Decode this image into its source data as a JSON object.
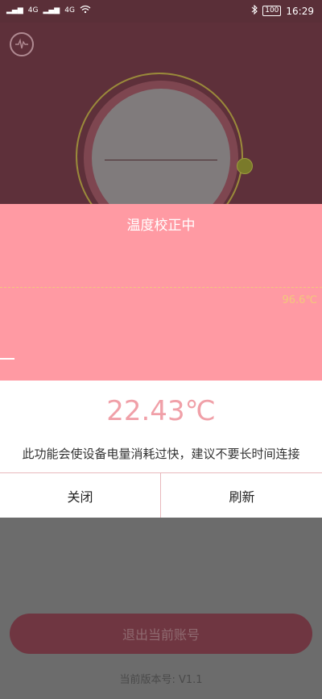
{
  "status_bar": {
    "left_indicators": [
      "4G",
      "4G"
    ],
    "battery": "100",
    "time": "16:29"
  },
  "calibration": {
    "title": "温度校正中",
    "reference_value": "96.6℃"
  },
  "panel": {
    "temperature": "22.43℃",
    "warning": "此功能会使设备电量消耗过快，建议不要长时间连接",
    "close_label": "关闭",
    "refresh_label": "刷新"
  },
  "footer": {
    "logout_label": "退出当前账号",
    "version_label": "当前版本号: V1.1"
  },
  "colors": {
    "accent_pink": "#ff9aa3",
    "temp_text": "#f0a0a8",
    "dark_bg": "#5e303a",
    "reference_line": "#f2c87b"
  },
  "icons": {
    "status_bluetooth": "bluetooth-icon",
    "status_wifi": "wifi-icon",
    "status_signal": "signal-icon",
    "wave": "waveform-icon"
  }
}
